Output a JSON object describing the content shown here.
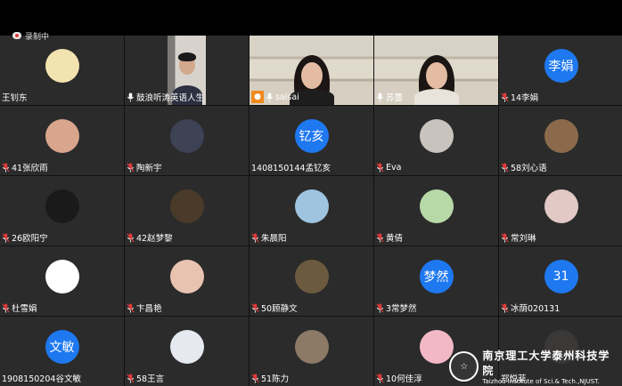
{
  "recording": {
    "label": "录制中"
  },
  "participants": [
    {
      "name": "王钊东",
      "avatar_type": "photo",
      "avatar_color": "#f3e3b0",
      "mic": false
    },
    {
      "name": "鼓浪听涛英语人生",
      "avatar_type": "video",
      "mic": true
    },
    {
      "name": "saisai",
      "avatar_type": "video",
      "mic": true,
      "badge_icon": "host-icon",
      "badge_color": "#f08a1e"
    },
    {
      "name": "苏蕾",
      "avatar_type": "video",
      "mic": true
    },
    {
      "name": "14李娟",
      "avatar_type": "text",
      "avatar_text": "李娟",
      "mic": true
    },
    {
      "name": "41张欣雨",
      "avatar_type": "photo",
      "avatar_color": "#d9a58c",
      "mic": true
    },
    {
      "name": "陶新宇",
      "avatar_type": "photo",
      "avatar_color": "#3d4254",
      "mic": true
    },
    {
      "name": "1408150144孟钇亥",
      "avatar_type": "text",
      "avatar_text": "钇亥",
      "mic": false
    },
    {
      "name": "Eva",
      "avatar_type": "photo",
      "avatar_color": "#c9c3bd",
      "mic": true
    },
    {
      "name": "58刘心语",
      "avatar_type": "photo",
      "avatar_color": "#8a6a4a",
      "mic": true
    },
    {
      "name": "26欧阳宁",
      "avatar_type": "photo",
      "avatar_color": "#1a1a1a",
      "mic": true
    },
    {
      "name": "42赵梦黎",
      "avatar_type": "photo",
      "avatar_color": "#4a3a2a",
      "mic": true
    },
    {
      "name": "朱晨阳",
      "avatar_type": "photo",
      "avatar_color": "#9fc4e0",
      "mic": true
    },
    {
      "name": "黄倩",
      "avatar_type": "photo",
      "avatar_color": "#b7d9a8",
      "mic": true
    },
    {
      "name": "常刘琳",
      "avatar_type": "photo",
      "avatar_color": "#e2c9c6",
      "mic": true
    },
    {
      "name": "杜雪娟",
      "avatar_type": "photo",
      "avatar_color": "#ffffff",
      "mic": true
    },
    {
      "name": "卞昌艳",
      "avatar_type": "photo",
      "avatar_color": "#e7c3b0",
      "mic": true
    },
    {
      "name": "50顾静文",
      "avatar_type": "photo",
      "avatar_color": "#6b5a3e",
      "mic": true
    },
    {
      "name": "3常梦然",
      "avatar_type": "text",
      "avatar_text": "梦然",
      "mic": true
    },
    {
      "name": "冰荫020131",
      "avatar_type": "text",
      "avatar_text": "31",
      "mic": true
    },
    {
      "name": "1908150204谷文敏",
      "avatar_type": "text",
      "avatar_text": "文敏",
      "mic": false
    },
    {
      "name": "58王言",
      "avatar_type": "photo",
      "avatar_color": "#e6e9f0",
      "mic": true
    },
    {
      "name": "51陈力",
      "avatar_type": "photo",
      "avatar_color": "#8c7a66",
      "mic": true
    },
    {
      "name": "10何佳淳",
      "avatar_type": "photo",
      "avatar_color": "#f2b8c6",
      "mic": true
    },
    {
      "name": "郑悦菲",
      "avatar_type": "photo",
      "avatar_color": "#3b3838",
      "mic": false
    }
  ],
  "watermark": {
    "chinese": "南京理工大学泰州科技学院",
    "english": "Taizhou Institute of Sci.& Tech.,NJUST.",
    "logo_text": "☆"
  },
  "colors": {
    "tile_bg": "#2b2b2b",
    "avatar_blue": "#1e78f0",
    "mic_red": "#e03a3a"
  }
}
